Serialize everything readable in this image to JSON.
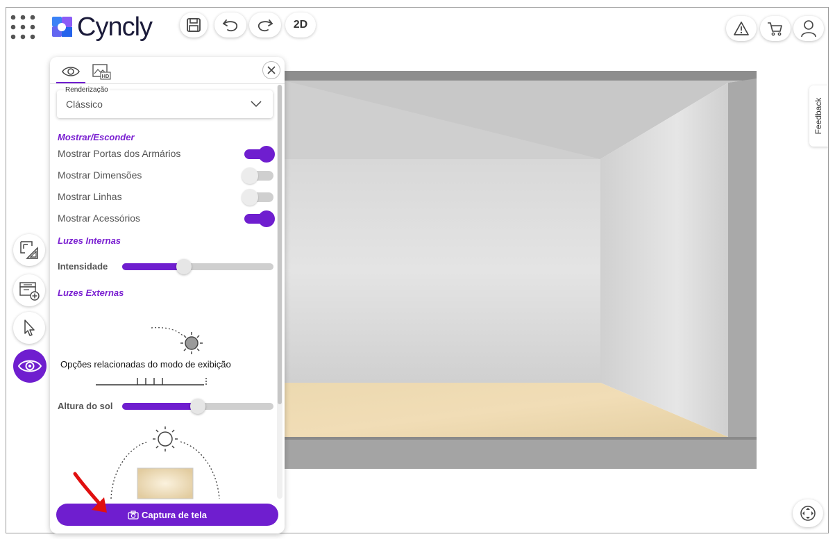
{
  "header": {
    "brand": "Cyncly",
    "view_mode_label": "2D"
  },
  "panel": {
    "render": {
      "label": "Renderização",
      "value": "Clássico"
    },
    "show_hide": {
      "title": "Mostrar/Esconder",
      "items": [
        {
          "label": "Mostrar Portas dos Armários",
          "on": true
        },
        {
          "label": "Mostrar Dimensões",
          "on": false
        },
        {
          "label": "Mostrar Linhas",
          "on": false
        },
        {
          "label": "Mostrar Acessórios",
          "on": true
        }
      ]
    },
    "internal_lights": {
      "title": "Luzes Internas",
      "intensity_label": "Intensidade",
      "intensity_value": 0.41
    },
    "external_lights": {
      "title": "Luzes Externas",
      "sun_height_label": "Altura do sol",
      "sun_height_value": 0.5
    },
    "tooltip": "Opções relacionadas do modo de exibição",
    "screenshot_button": "Captura de tela"
  },
  "feedback_label": "Feedback",
  "colors": {
    "accent": "#6f1ecf",
    "annotation_arrow": "#e01010"
  }
}
